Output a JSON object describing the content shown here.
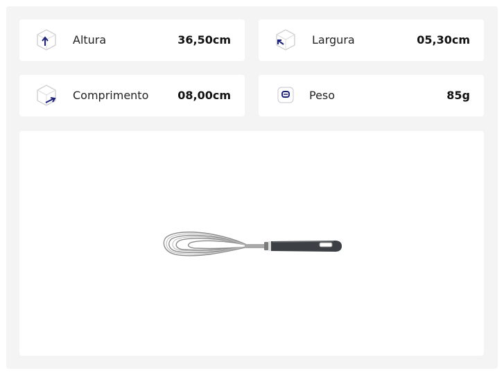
{
  "specs": [
    {
      "label": "Altura",
      "value": "36,50cm",
      "icon": "cube-height-icon"
    },
    {
      "label": "Largura",
      "value": "05,30cm",
      "icon": "cube-width-icon"
    },
    {
      "label": "Comprimento",
      "value": "08,00cm",
      "icon": "cube-length-icon"
    },
    {
      "label": "Peso",
      "value": "85g",
      "icon": "weight-icon"
    }
  ],
  "product": {
    "image": "whisk"
  },
  "colors": {
    "accent": "#1a1f7a",
    "background": "#f4f4f4",
    "card": "#ffffff"
  }
}
